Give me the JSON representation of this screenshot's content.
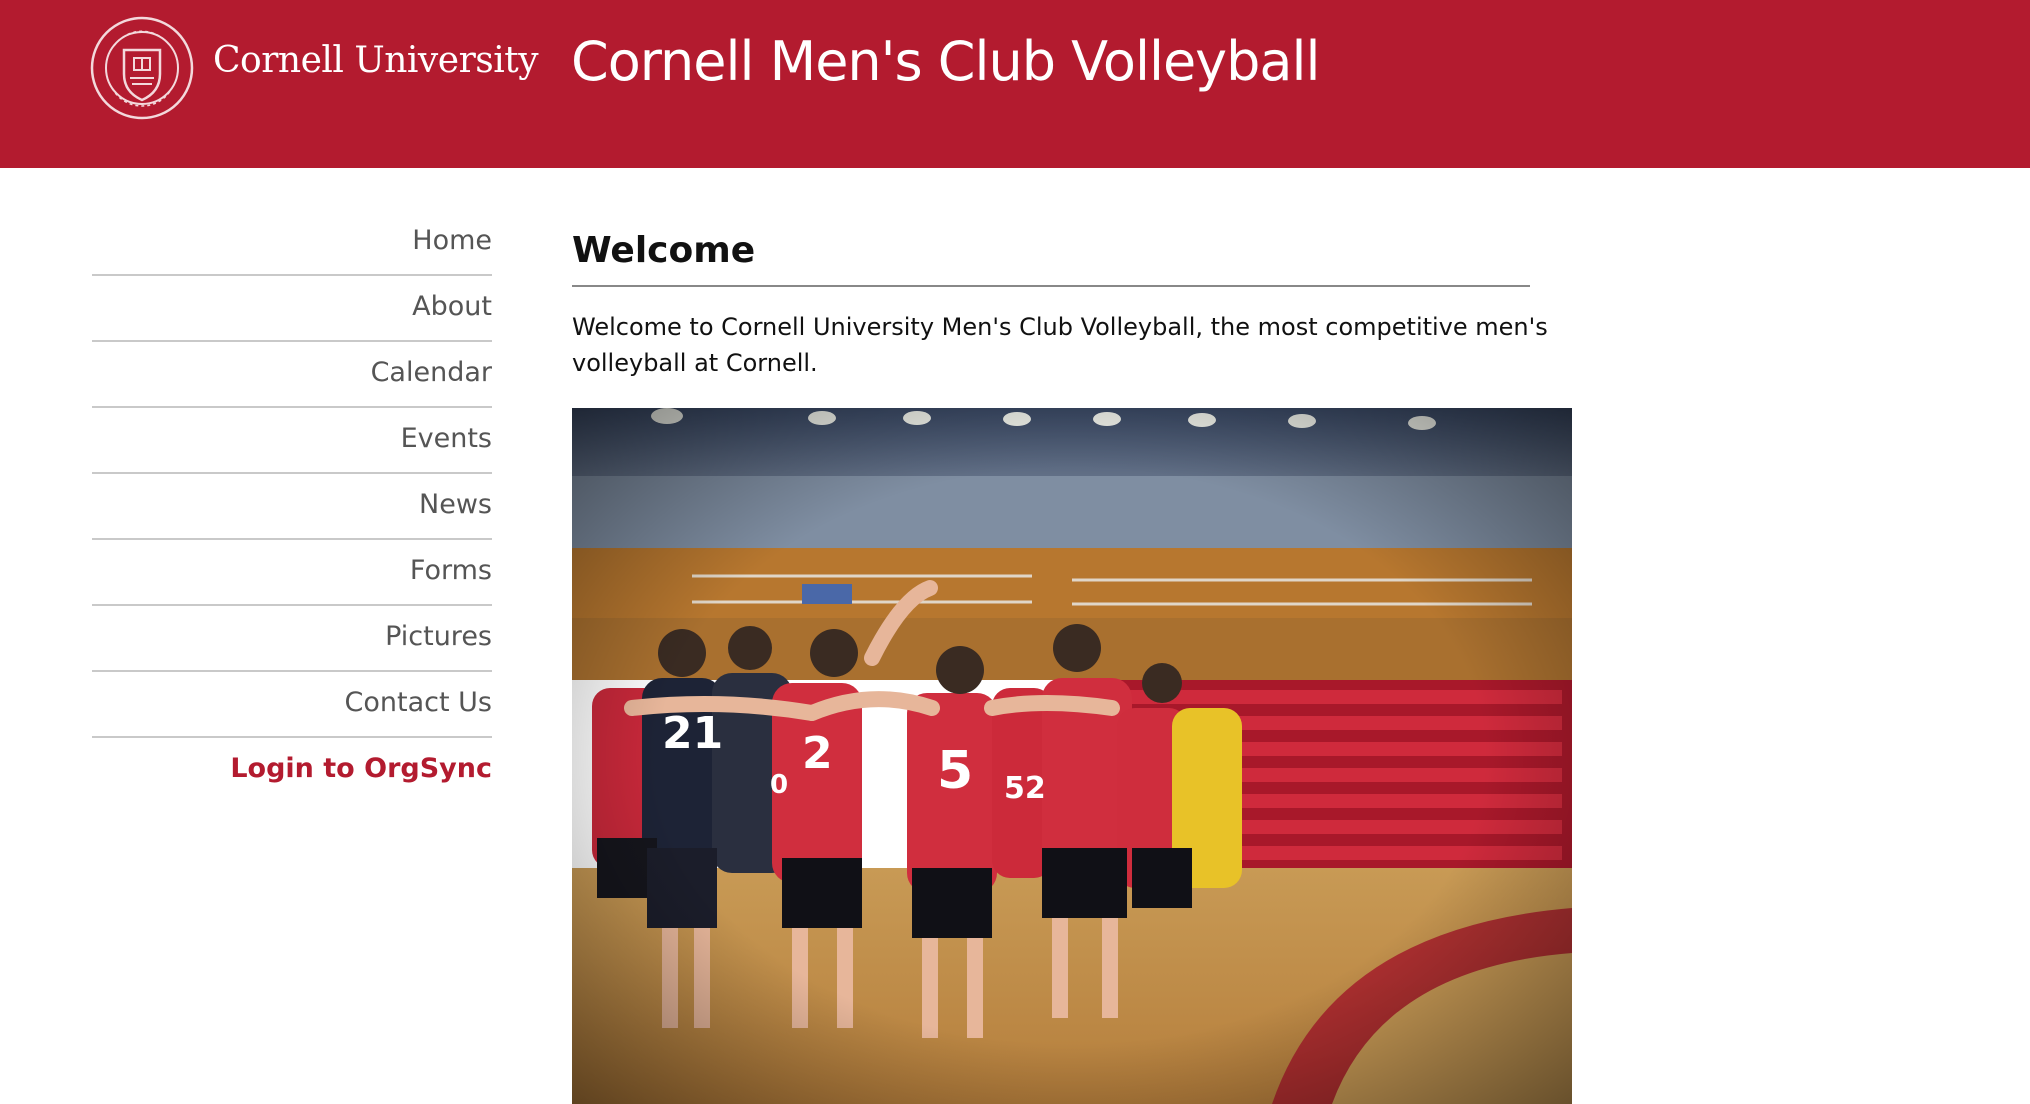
{
  "header": {
    "university_name": "Cornell University",
    "site_title": "Cornell Men's Club Volleyball",
    "brand_color": "#b31b2f"
  },
  "sidebar": {
    "items": [
      {
        "label": "Home"
      },
      {
        "label": "About"
      },
      {
        "label": "Calendar"
      },
      {
        "label": "Events"
      },
      {
        "label": "News"
      },
      {
        "label": "Forms"
      },
      {
        "label": "Pictures"
      },
      {
        "label": "Contact Us"
      }
    ],
    "login_label": "Login to OrgSync",
    "login_color": "#b31b2f"
  },
  "main": {
    "heading": "Welcome",
    "intro": "Welcome to Cornell University Men's Club Volleyball, the most competitive men's volleyball at Cornell.",
    "photo": {
      "jersey_numbers": [
        "21",
        "2",
        "5",
        "52",
        "0"
      ]
    }
  }
}
